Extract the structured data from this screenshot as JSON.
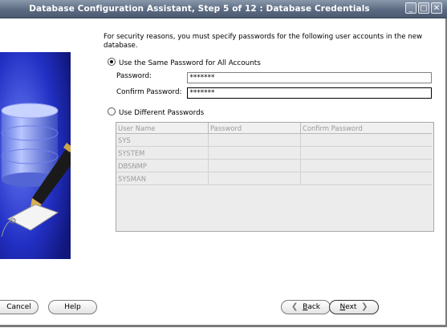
{
  "window": {
    "title": "Database Configuration Assistant, Step 5 of 12 : Database Credentials",
    "controls": {
      "minimize": "_",
      "maximize": "□",
      "close": "✕"
    }
  },
  "intro": "For security reasons, you must specify passwords for the following user accounts in the new database.",
  "same_password": {
    "label": "Use the Same Password for All Accounts",
    "selected": true,
    "password_label": "Password:",
    "password_value": "*******",
    "confirm_label": "Confirm Password:",
    "confirm_value": "*******"
  },
  "different_passwords": {
    "label": "Use Different Passwords",
    "selected": false,
    "columns": [
      "User Name",
      "Password",
      "Confirm Password"
    ],
    "rows": [
      {
        "user": "SYS",
        "password": "",
        "confirm": ""
      },
      {
        "user": "SYSTEM",
        "password": "",
        "confirm": ""
      },
      {
        "user": "DBSNMP",
        "password": "",
        "confirm": ""
      },
      {
        "user": "SYSMAN",
        "password": "",
        "confirm": ""
      }
    ]
  },
  "buttons": {
    "cancel": "Cancel",
    "help": "Help",
    "back_mnemonic": "B",
    "back_rest": "ack",
    "next_mnemonic": "N",
    "next_rest": "ext"
  }
}
